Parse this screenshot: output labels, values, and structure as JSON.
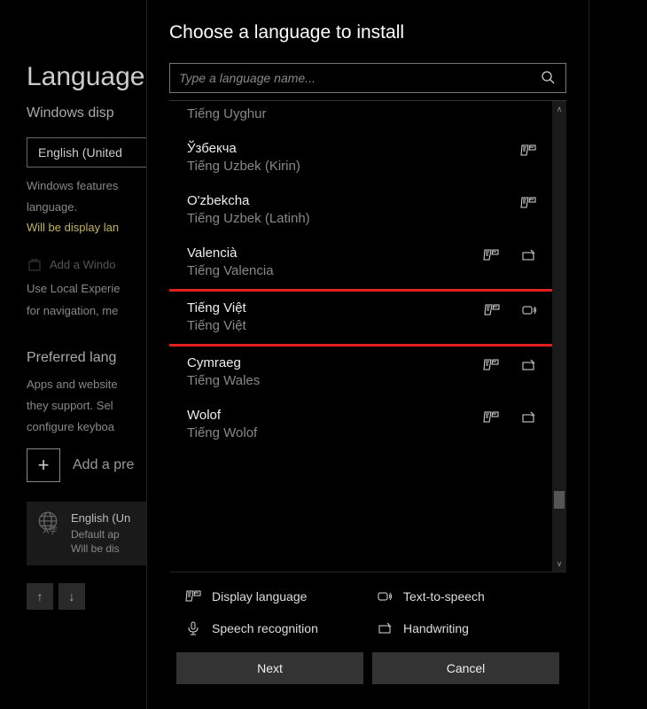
{
  "bg": {
    "title": "Language",
    "subtitle": "Windows disp",
    "dropdown": "English (United",
    "text1": "Windows features",
    "text2": "language.",
    "warn": "Will be display lan",
    "addLink": "Add a Windo",
    "useLocal1": "Use Local Experie",
    "useLocal2": "for navigation, me",
    "prefTitle": "Preferred lang",
    "prefText1": "Apps and website",
    "prefText2": "they support. Sel",
    "prefText3": "configure keyboa",
    "addPref": "Add a pre",
    "cardName": "English (Un",
    "cardDefault": "Default ap",
    "cardWill": "Will be dis"
  },
  "dialog": {
    "title": "Choose a language to install",
    "placeholder": "Type a language name...",
    "nextLabel": "Next",
    "cancelLabel": "Cancel"
  },
  "legend": {
    "display": "Display language",
    "tts": "Text-to-speech",
    "speech": "Speech recognition",
    "handwriting": "Handwriting"
  },
  "langs": [
    {
      "native": "",
      "local": "Tiếng Uyghur",
      "disp": false,
      "tts": false,
      "hw": false,
      "partial": true
    },
    {
      "native": "Ўзбекча",
      "local": "Tiếng Uzbek (Kirin)",
      "disp": true,
      "tts": false,
      "hw": false
    },
    {
      "native": "O'zbekcha",
      "local": "Tiếng Uzbek (Latinh)",
      "disp": true,
      "tts": false,
      "hw": false
    },
    {
      "native": "Valencià",
      "local": "Tiếng Valencia",
      "disp": true,
      "tts": false,
      "hw": true
    },
    {
      "native": "Tiếng Việt",
      "local": "Tiếng Việt",
      "disp": true,
      "tts": true,
      "hw": false,
      "highlighted": true
    },
    {
      "native": "Cymraeg",
      "local": "Tiếng Wales",
      "disp": true,
      "tts": false,
      "hw": true
    },
    {
      "native": "Wolof",
      "local": "Tiếng Wolof",
      "disp": true,
      "tts": false,
      "hw": true
    }
  ],
  "scroll": {
    "thumbTop": 440,
    "thumbHeight": 20
  }
}
